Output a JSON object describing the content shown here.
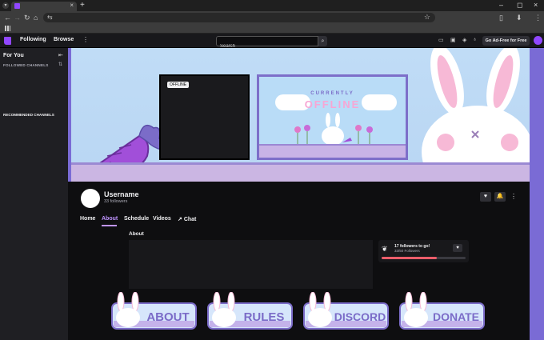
{
  "browser": {
    "new_tab": "+",
    "tab_close": "×",
    "window_controls": [
      "–",
      "◻",
      "×"
    ],
    "nav_icons": [
      "←",
      "→",
      "↻",
      "⌂",
      "⇆"
    ],
    "toolbar_icons": [
      "▯",
      "⬇",
      "⋮"
    ]
  },
  "topnav": {
    "following": "Following",
    "browse": "Browse",
    "more": "⋮",
    "search_placeholder": "Search",
    "search_icon": "⌕",
    "ad_free": "Go Ad-Free for Free",
    "icon_names": [
      "crown-icon",
      "inbox-icon",
      "bits-icon",
      "notifications-icon"
    ]
  },
  "sidebar": {
    "title": "For You",
    "followed_header": "FOLLOWED CHANNELS",
    "recommended_header": "RECOMMENDED CHANNELS"
  },
  "banner": {
    "offline_badge": "OFFLINE",
    "currently": "CURRENTLY",
    "offline_word": "OFFLINE"
  },
  "channel": {
    "name": "Username",
    "followers": "33 followers"
  },
  "tabs": [
    {
      "label": "Home"
    },
    {
      "label": "About"
    },
    {
      "label": "Schedule"
    },
    {
      "label": "Videos"
    },
    {
      "label": "Chat"
    }
  ],
  "about_label": "About",
  "goal": {
    "title": "17 followers to go!",
    "subtitle": "33/50 Followers",
    "progress": 0.66
  },
  "panels": [
    {
      "label": "ABOUT"
    },
    {
      "label": "RULES"
    },
    {
      "label": "DISCORD"
    },
    {
      "label": "DONATE"
    }
  ],
  "colors": {
    "accent": "#9147ff",
    "banner_sky": "#c0dcf6",
    "panel_fill": "#d6e6fb",
    "panel_text": "#7b6cc8"
  }
}
